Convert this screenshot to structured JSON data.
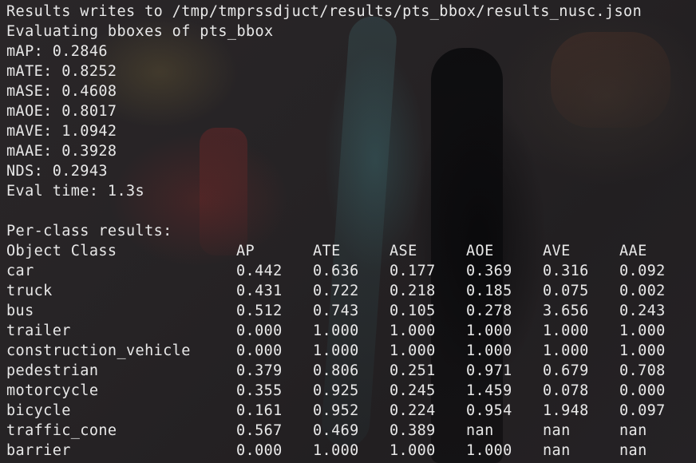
{
  "terminal": {
    "lines": [
      "Results writes to /tmp/tmprssdjuct/results/pts_bbox/results_nusc.json",
      "Evaluating bboxes of pts_bbox",
      "mAP: 0.2846",
      "mATE: 0.8252",
      "mASE: 0.4608",
      "mAOE: 0.8017",
      "mAVE: 1.0942",
      "mAAE: 0.3928",
      "NDS: 0.2943",
      "Eval time: 1.3s",
      "",
      "Per-class results:"
    ],
    "table": {
      "headers": [
        "Object Class",
        "AP",
        "ATE",
        "ASE",
        "AOE",
        "AVE",
        "AAE"
      ],
      "rows": [
        [
          "car",
          "0.442",
          "0.636",
          "0.177",
          "0.369",
          "0.316",
          "0.092"
        ],
        [
          "truck",
          "0.431",
          "0.722",
          "0.218",
          "0.185",
          "0.075",
          "0.002"
        ],
        [
          "bus",
          "0.512",
          "0.743",
          "0.105",
          "0.278",
          "3.656",
          "0.243"
        ],
        [
          "trailer",
          "0.000",
          "1.000",
          "1.000",
          "1.000",
          "1.000",
          "1.000"
        ],
        [
          "construction_vehicle",
          "0.000",
          "1.000",
          "1.000",
          "1.000",
          "1.000",
          "1.000"
        ],
        [
          "pedestrian",
          "0.379",
          "0.806",
          "0.251",
          "0.971",
          "0.679",
          "0.708"
        ],
        [
          "motorcycle",
          "0.355",
          "0.925",
          "0.245",
          "1.459",
          "0.078",
          "0.000"
        ],
        [
          "bicycle",
          "0.161",
          "0.952",
          "0.224",
          "0.954",
          "1.948",
          "0.097"
        ],
        [
          "traffic_cone",
          "0.567",
          "0.469",
          "0.389",
          "nan",
          "nan",
          "nan"
        ],
        [
          "barrier",
          "0.000",
          "1.000",
          "1.000",
          "1.000",
          "nan",
          "nan"
        ]
      ]
    }
  },
  "colors": {
    "text": "#e8e8e8",
    "background": "#242123"
  }
}
